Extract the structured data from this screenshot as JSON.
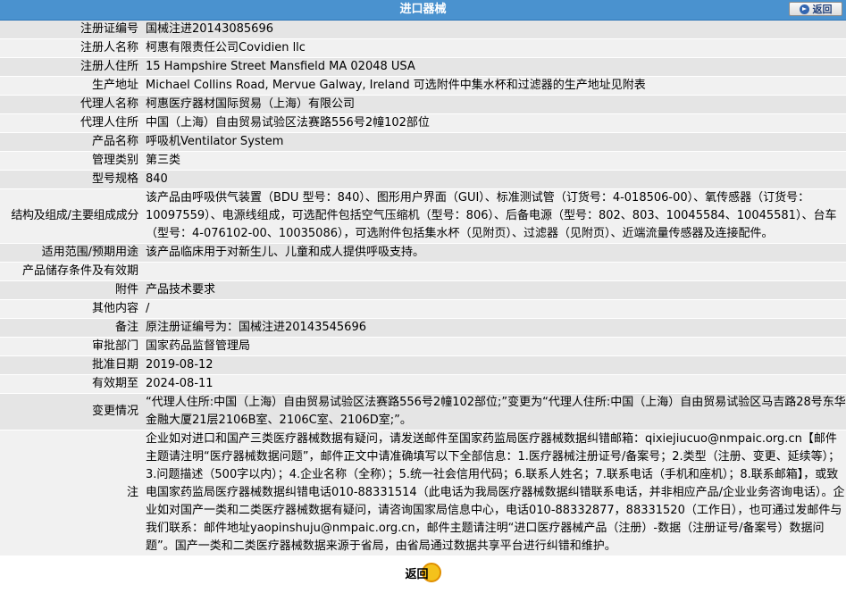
{
  "header": {
    "title": "进口器械",
    "back_label": "返回"
  },
  "rows": [
    {
      "key": "注册证编号",
      "value": "国械注进20143085696"
    },
    {
      "key": "注册人名称",
      "value": "柯惠有限责任公司Covidien llc"
    },
    {
      "key": "注册人住所",
      "value": "15 Hampshire Street Mansfield MA 02048 USA"
    },
    {
      "key": "生产地址",
      "value": "Michael Collins Road, Mervue Galway, Ireland 可选附件中集水杯和过滤器的生产地址见附表"
    },
    {
      "key": "代理人名称",
      "value": "柯惠医疗器材国际贸易（上海）有限公司"
    },
    {
      "key": "代理人住所",
      "value": "中国（上海）自由贸易试验区法赛路556号2幢102部位"
    },
    {
      "key": "产品名称",
      "value": "呼吸机Ventilator System"
    },
    {
      "key": "管理类别",
      "value": "第三类"
    },
    {
      "key": "型号规格",
      "value": "840"
    },
    {
      "key": "结构及组成/主要组成成分",
      "value": "该产品由呼吸供气装置（BDU 型号：840）、图形用户界面（GUI）、标准测试管（订货号：4-018506-00）、氧传感器（订货号：10097559）、电源线组成，可选配件包括空气压缩机（型号：806）、后备电源（型号：802、803、10045584、10045581）、台车（型号：4-076102-00、10035086），可选附件包括集水杯（见附页）、过滤器（见附页）、近端流量传感器及连接配件。"
    },
    {
      "key": "适用范围/预期用途",
      "value": "该产品临床用于对新生儿、儿童和成人提供呼吸支持。"
    },
    {
      "key": "产品储存条件及有效期",
      "value": ""
    },
    {
      "key": "附件",
      "value": "产品技术要求"
    },
    {
      "key": "其他内容",
      "value": "/"
    },
    {
      "key": "备注",
      "value": "原注册证编号为：国械注进20143545696"
    },
    {
      "key": "审批部门",
      "value": "国家药品监督管理局"
    },
    {
      "key": "批准日期",
      "value": "2019-08-12"
    },
    {
      "key": "有效期至",
      "value": "2024-08-11"
    },
    {
      "key": "变更情况",
      "value": "“代理人住所:中国（上海）自由贸易试验区法赛路556号2幢102部位;”变更为“代理人住所:中国（上海）自由贸易试验区马吉路28号东华金融大厦21层2106B室、2106C室、2106D室;”。"
    }
  ],
  "note": {
    "key": "注",
    "text": "企业如对进口和国产三类医疗器械数据有疑问，请发送邮件至国家药监局医疗器械数据纠错邮箱：qixiejiucuo@nmpaic.org.cn【邮件主题请注明“医疗器械数据问题”，邮件正文中请准确填写以下全部信息：1.医疗器械注册证号/备案号；2.类型（注册、变更、延续等）；3.问题描述（500字以内）；4.企业名称（全称）；5.统一社会信用代码；6.联系人姓名；7.联系电话（手机和座机）；8.联系邮箱】，或致电国家药监局医疗器械数据纠错电话010-88331514（此电话为我局医疗器械数据纠错联系电话，并非相应产品/企业业务咨询电话）。企业如对国产一类和二类医疗器械数据有疑问，请咨询国家局信息中心，电话010-88332877，88331520（工作日），也可通过发邮件与我们联系：邮件地址yaopinshuju@nmpaic.org.cn，邮件主题请注明“进口医疗器械产品（注册）-数据（注册证号/备案号）数据问题”。国产一类和二类医疗器械数据来源于省局，由省局通过数据共享平台进行纠错和维护。"
  },
  "footer": {
    "back_label": "返回"
  },
  "colors": {
    "header_bg": "#4a92cf",
    "row_odd": "#e5e5e5",
    "row_even": "#f1f1f1",
    "note_text": "#1a4ea6",
    "button_ring": "#f4c21c"
  }
}
